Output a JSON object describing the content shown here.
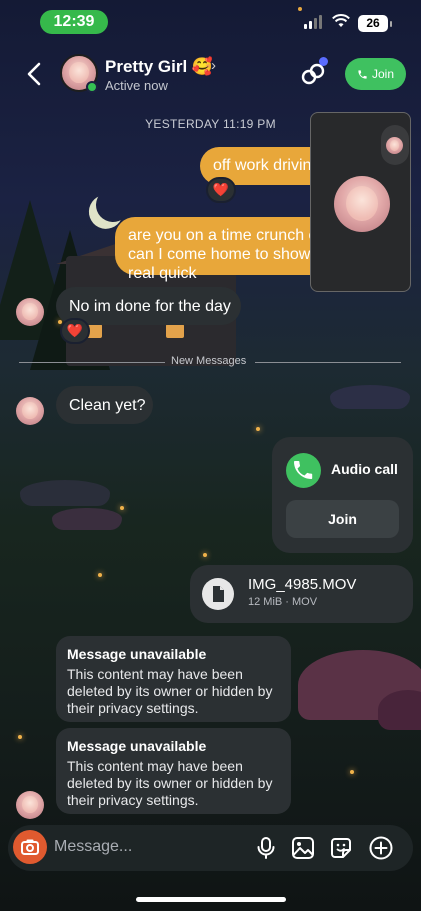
{
  "status_bar": {
    "time": "12:39",
    "battery": "26"
  },
  "header": {
    "back_label": "back",
    "contact_name": "Pretty Girl 🥰",
    "presence": "Active now",
    "join_label": "Join"
  },
  "date_separator": "YESTERDAY 11:19 PM",
  "messages": {
    "out_1": "off work driving",
    "out_1_reaction": "❤️",
    "out_2": "are you on a time crunch or can I come home to shower real quick",
    "in_1": "No im done for the day",
    "in_1_reaction": "❤️",
    "new_messages_label": "New Messages",
    "in_2": "Clean yet?"
  },
  "audio_call": {
    "label": "Audio call",
    "join_label": "Join"
  },
  "file": {
    "name": "IMG_4985.MOV",
    "meta": "12 MiB · MOV"
  },
  "unavailable": [
    {
      "title": "Message unavailable",
      "body": "This content may have been deleted by its owner or hidden by their privacy settings."
    },
    {
      "title": "Message unavailable",
      "body": "This content may have been deleted by its owner or hidden by their privacy settings."
    }
  ],
  "composer": {
    "placeholder": "Message..."
  },
  "colors": {
    "accent_green": "#3fc160",
    "outgoing_bubble": "#e8a73a",
    "incoming_bubble": "#2b3033",
    "camera": "#e05a2f"
  },
  "icons": [
    "back-icon",
    "link-icon",
    "phone-icon",
    "camera-icon",
    "mic-icon",
    "image-icon",
    "sticker-icon",
    "plus-icon",
    "file-icon",
    "heart-icon"
  ]
}
